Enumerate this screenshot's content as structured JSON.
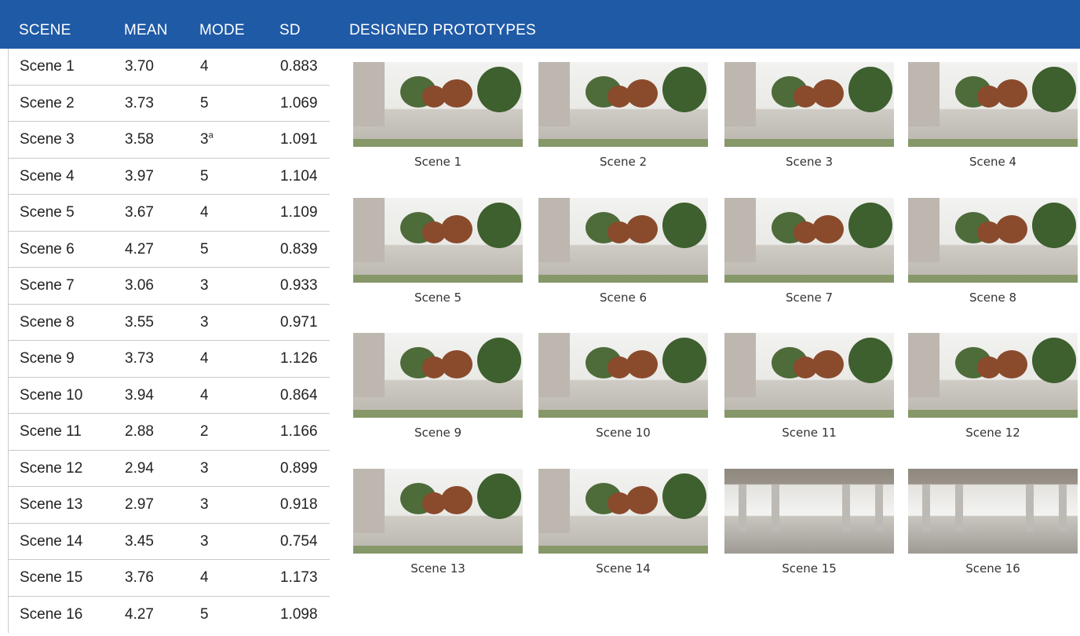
{
  "headers": {
    "scene": "SCENE",
    "mean": "MEAN",
    "mode": "MODE",
    "sd": "SD",
    "prototypes": "DESIGNED PROTOTYPES"
  },
  "rows": [
    {
      "scene": "Scene 1",
      "mean": "3.70",
      "mode": "4",
      "sd": "0.883"
    },
    {
      "scene": "Scene 2",
      "mean": "3.73",
      "mode": "5",
      "sd": "1.069"
    },
    {
      "scene": "Scene 3",
      "mean": "3.58",
      "mode": "3",
      "mode_sup": "a",
      "sd": "1.091"
    },
    {
      "scene": "Scene 4",
      "mean": "3.97",
      "mode": "5",
      "sd": "1.104"
    },
    {
      "scene": "Scene 5",
      "mean": "3.67",
      "mode": "4",
      "sd": "1.109"
    },
    {
      "scene": "Scene 6",
      "mean": "4.27",
      "mode": "5",
      "sd": "0.839"
    },
    {
      "scene": "Scene 7",
      "mean": "3.06",
      "mode": "3",
      "sd": "0.933"
    },
    {
      "scene": "Scene 8",
      "mean": "3.55",
      "mode": "3",
      "sd": "0.971"
    },
    {
      "scene": "Scene 9",
      "mean": "3.73",
      "mode": "4",
      "sd": "1.126"
    },
    {
      "scene": "Scene 10",
      "mean": "3.94",
      "mode": "4",
      "sd": "0.864"
    },
    {
      "scene": "Scene 11",
      "mean": "2.88",
      "mode": "2",
      "sd": "1.166"
    },
    {
      "scene": "Scene 12",
      "mean": "2.94",
      "mode": "3",
      "sd": "0.899"
    },
    {
      "scene": "Scene 13",
      "mean": "2.97",
      "mode": "3",
      "sd": "0.918"
    },
    {
      "scene": "Scene 14",
      "mean": "3.45",
      "mode": "3",
      "sd": "0.754"
    },
    {
      "scene": "Scene 15",
      "mean": "3.76",
      "mode": "4",
      "sd": "1.173"
    },
    {
      "scene": "Scene 16",
      "mean": "4.27",
      "mode": "5",
      "sd": "1.098"
    }
  ],
  "prototypes": [
    {
      "caption": "Scene 1"
    },
    {
      "caption": "Scene 2"
    },
    {
      "caption": "Scene 3"
    },
    {
      "caption": "Scene 4"
    },
    {
      "caption": "Scene 5"
    },
    {
      "caption": "Scene 6"
    },
    {
      "caption": "Scene 7"
    },
    {
      "caption": "Scene 8"
    },
    {
      "caption": "Scene 9"
    },
    {
      "caption": "Scene 10"
    },
    {
      "caption": "Scene 11"
    },
    {
      "caption": "Scene 12"
    },
    {
      "caption": "Scene 13"
    },
    {
      "caption": "Scene 14"
    },
    {
      "caption": "Scene 15"
    },
    {
      "caption": "Scene 16"
    }
  ],
  "colors": {
    "header_bg": "#1f5aa6",
    "header_text": "#ffffff"
  }
}
